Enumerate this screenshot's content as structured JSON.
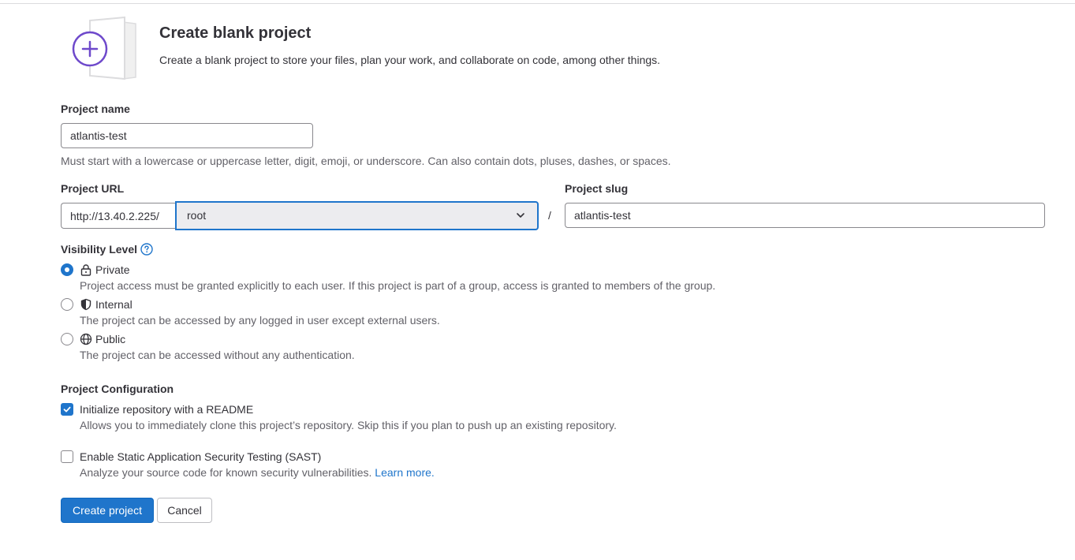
{
  "header": {
    "title": "Create blank project",
    "description": "Create a blank project to store your files, plan your work, and collaborate on code, among other things."
  },
  "project_name": {
    "label": "Project name",
    "value": "atlantis-test",
    "help": "Must start with a lowercase or uppercase letter, digit, emoji, or underscore. Can also contain dots, pluses, dashes, or spaces."
  },
  "project_url": {
    "label": "Project URL",
    "prefix": "http://13.40.2.225/",
    "namespace": "root",
    "separator": "/"
  },
  "project_slug": {
    "label": "Project slug",
    "value": "atlantis-test"
  },
  "visibility": {
    "label": "Visibility Level",
    "help_icon": "question-circle-icon",
    "options": [
      {
        "label": "Private",
        "icon": "lock-icon",
        "checked": true,
        "description": "Project access must be granted explicitly to each user. If this project is part of a group, access is granted to members of the group."
      },
      {
        "label": "Internal",
        "icon": "shield-icon",
        "checked": false,
        "description": "The project can be accessed by any logged in user except external users."
      },
      {
        "label": "Public",
        "icon": "globe-icon",
        "checked": false,
        "description": "The project can be accessed without any authentication."
      }
    ]
  },
  "configuration": {
    "label": "Project Configuration",
    "readme": {
      "label": "Initialize repository with a README",
      "checked": true,
      "description": "Allows you to immediately clone this project’s repository. Skip this if you plan to push up an existing repository."
    },
    "sast": {
      "label": "Enable Static Application Security Testing (SAST)",
      "checked": false,
      "description": "Analyze your source code for known security vulnerabilities.",
      "link": "Learn more."
    }
  },
  "actions": {
    "create": "Create project",
    "cancel": "Cancel"
  },
  "colors": {
    "accent": "#1f75cb",
    "illustration_purple": "#6e49cb",
    "text": "#333238",
    "muted": "#626168"
  }
}
